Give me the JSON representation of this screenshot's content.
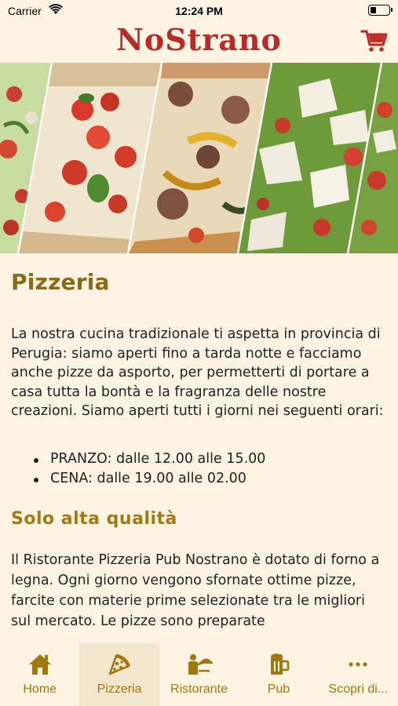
{
  "status_bar": {
    "carrier": "Carrier",
    "time": "12:24 PM",
    "battery_level": 0.3
  },
  "header": {
    "logo_text": "NoStrano",
    "cart_icon": "shopping-cart-icon"
  },
  "banner": {
    "panels": [
      "pizza-tomato-basil",
      "pizza-sausage-peppers",
      "pizza-rocket-parmesan"
    ]
  },
  "content": {
    "title": "Pizzeria",
    "intro": "La nostra cucina tradizionale ti aspetta in provincia di Perugia: siamo aperti fino a tarda notte e facciamo anche pizze da asporto, per permetterti di portare a casa tutta la bontà e la fragranza delle nostre creazioni.  Siamo aperti tutti i giorni nei seguenti orari:",
    "hours": [
      "PRANZO: dalle 12.00 alle 15.00",
      "CENA: dalle 19.00 alle 02.00"
    ],
    "subtitle": "Solo alta qualità",
    "body": "Il Ristorante Pizzeria Pub Nostrano è dotato di forno a legna. Ogni giorno vengono sfornate ottime pizze, farcite con materie prime selezionate tra le migliori sul mercato. Le pizze sono preparate"
  },
  "tabs": [
    {
      "label": "Home",
      "icon": "home-icon"
    },
    {
      "label": "Pizzeria",
      "icon": "pizza-icon",
      "active": true
    },
    {
      "label": "Ristorante",
      "icon": "waiter-icon"
    },
    {
      "label": "Pub",
      "icon": "beer-mug-icon"
    },
    {
      "label": "Scopri di...",
      "icon": "more-icon"
    }
  ],
  "colors": {
    "accent": "#a0780f",
    "title": "#8a6a12",
    "logo": "#b62b2b",
    "background": "#fdf4e4",
    "active_tab": "#f2e7ce"
  }
}
